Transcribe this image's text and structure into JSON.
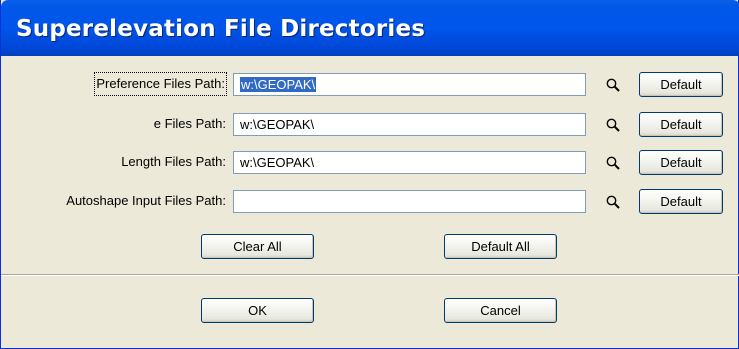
{
  "window": {
    "title": "Superelevation File Directories"
  },
  "paths": [
    {
      "label": "Preference Files Path:",
      "value": "w:\\GEOPAK\\",
      "default_label": "Default",
      "search_icon": "magnifier-icon"
    },
    {
      "label": "e Files Path:",
      "value": "w:\\GEOPAK\\",
      "default_label": "Default",
      "search_icon": "magnifier-icon"
    },
    {
      "label": "Length Files Path:",
      "value": "w:\\GEOPAK\\",
      "default_label": "Default",
      "search_icon": "magnifier-icon"
    },
    {
      "label": "Autoshape Input Files Path:",
      "value": "",
      "default_label": "Default",
      "search_icon": "magnifier-icon"
    }
  ],
  "actions": {
    "clear_all_label": "Clear All",
    "default_all_label": "Default All"
  },
  "footer": {
    "ok_label": "OK",
    "cancel_label": "Cancel"
  },
  "colors": {
    "titlebar": "#0055ea",
    "dialog_bg": "#ece9d8",
    "selection": "#316ac5"
  }
}
